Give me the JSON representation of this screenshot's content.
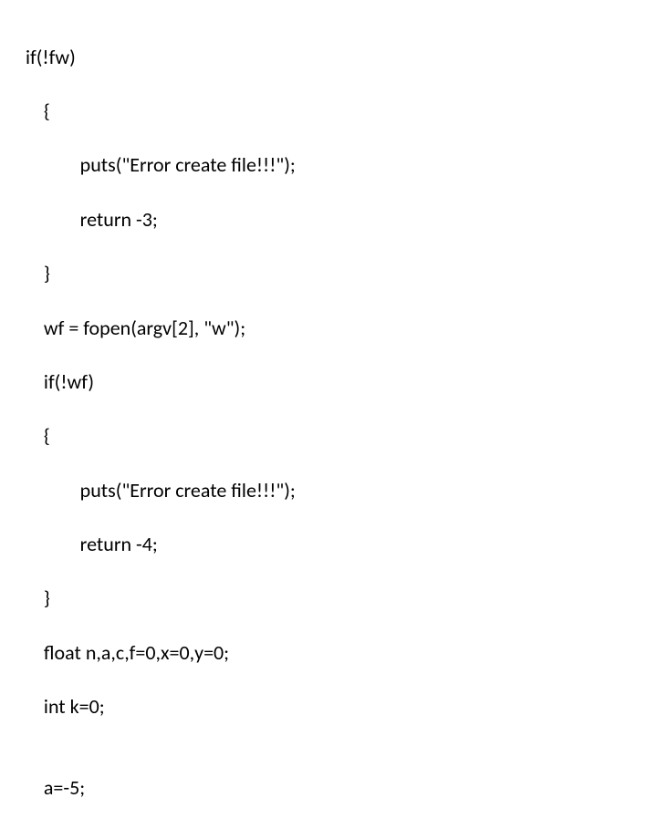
{
  "code": {
    "lines": [
      "if(!fw)",
      "    {",
      "            puts(\"Error create file!!!\");",
      "            return -3;",
      "    }",
      "    wf = fopen(argv[2], \"w\");",
      "    if(!wf)",
      "    {",
      "            puts(\"Error create file!!!\");",
      "            return -4;",
      "    }",
      "    float n,a,c,f=0,x=0,y=0;",
      "    int k=0;",
      "",
      "    a=-5;"
    ]
  }
}
